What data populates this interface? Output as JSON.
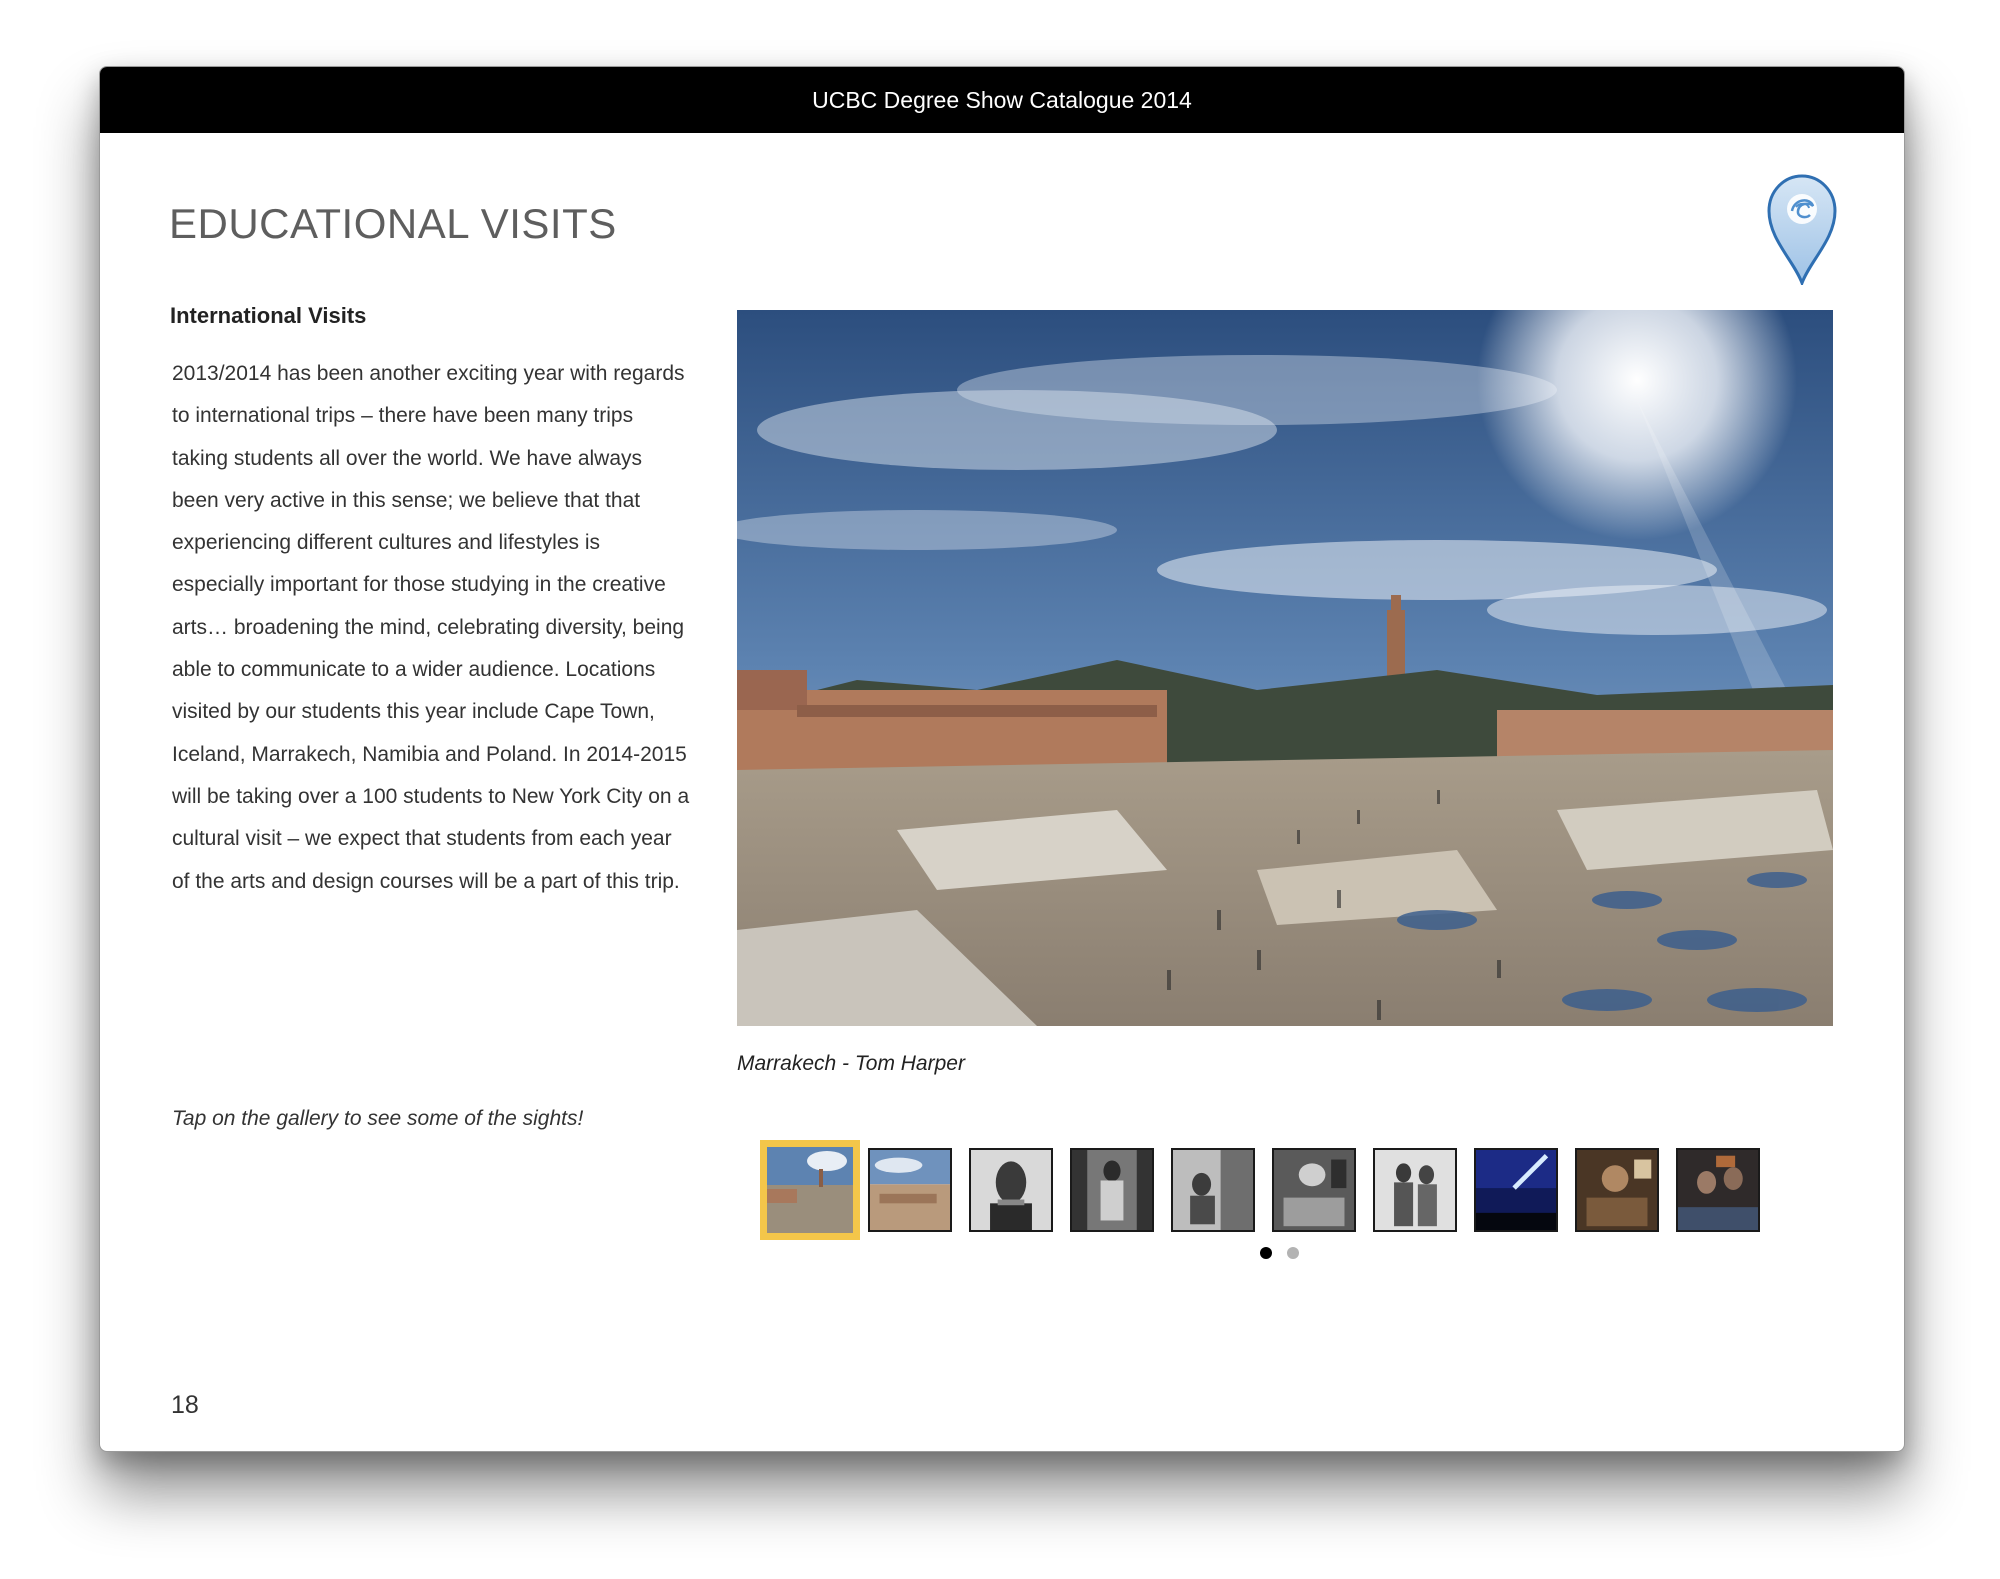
{
  "window": {
    "title": "UCBC Degree Show Catalogue 2014"
  },
  "page": {
    "heading": "EDUCATIONAL VISITS",
    "section_heading": "International Visits",
    "body": "2013/2014 has been another exciting year with regards to international trips – there have been many trips taking students all over the world. We have always been very active in this sense; we believe that that experiencing different cultures and lifestyles is especially important for those studying in the creative arts… broadening the mind, celebrating diversity, being able to communicate to a wider audience. Locations visited by our students this year include Cape Town, Iceland, Marrakech, Namibia and Poland. In 2014-2015 will be taking over a 100 students to New York City on a cultural visit – we expect that students from each year of the arts and design courses will be a part of this trip.",
    "tap_hint": "Tap on the gallery to see some of the sights!",
    "page_number": "18",
    "map_pin_icon": "map-pin-icon"
  },
  "gallery": {
    "caption": "Marrakech - Tom Harper",
    "selected_index": 0,
    "selected_color": "#f4c64a",
    "thumbnails": [
      {
        "subject": "marrakech-square",
        "style": "color"
      },
      {
        "subject": "marrakech-rooftops",
        "style": "color"
      },
      {
        "subject": "portrait",
        "style": "bw"
      },
      {
        "subject": "doorway-figure",
        "style": "bw"
      },
      {
        "subject": "street-scene",
        "style": "bw"
      },
      {
        "subject": "market-stall",
        "style": "bw"
      },
      {
        "subject": "group-figures",
        "style": "bw"
      },
      {
        "subject": "night-sky",
        "style": "color"
      },
      {
        "subject": "market-vendor",
        "style": "color"
      },
      {
        "subject": "crowd-market",
        "style": "color"
      }
    ],
    "pages": 2,
    "current_page": 0
  },
  "colors": {
    "titlebar": "#000000",
    "heading": "#5e5e5e",
    "pin_blue": "#4f8fce",
    "dot_active": "#000000",
    "dot_inactive": "#b3b3b3"
  }
}
